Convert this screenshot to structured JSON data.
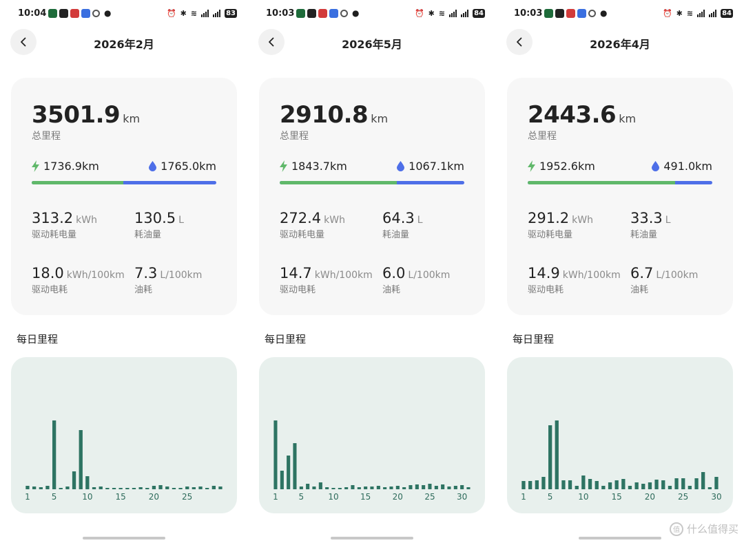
{
  "theme": {
    "accent_bar": "#2e7463",
    "elec_color": "#60b86a",
    "fuel_color": "#4e6fe8",
    "chart_bg": "#e8f0ed",
    "card_bg": "#f7f7f7"
  },
  "phones": [
    {
      "status": {
        "time": "10:04",
        "battery": "83"
      },
      "header": {
        "title": "2026年2月"
      },
      "summary": {
        "total_value": "3501.9",
        "total_unit": "km",
        "total_label": "总里程",
        "elec_km": "1736.9km",
        "fuel_km": "1765.0km",
        "elec_share": 0.496,
        "metrics": [
          {
            "value": "313.2",
            "unit": "kWh",
            "label": "驱动耗电量"
          },
          {
            "value": "130.5",
            "unit": "L",
            "label": "耗油量"
          },
          {
            "value": "18.0",
            "unit": "kWh/100km",
            "label": "驱动电耗"
          },
          {
            "value": "7.3",
            "unit": "L/100km",
            "label": "油耗"
          }
        ]
      },
      "section_title": "每日里程",
      "chart_data": {
        "type": "bar",
        "title": "",
        "categories": [
          1,
          2,
          3,
          4,
          5,
          6,
          7,
          8,
          9,
          10,
          11,
          12,
          13,
          14,
          15,
          16,
          17,
          18,
          19,
          20,
          21,
          22,
          23,
          24,
          25,
          26,
          27,
          28
        ],
        "tick_labels": [
          "1",
          "5",
          "10",
          "15",
          "20",
          "25"
        ],
        "tick_positions": [
          1,
          5,
          10,
          15,
          20,
          25
        ],
        "values": [
          5,
          4,
          3,
          5,
          100,
          2,
          4,
          26,
          86,
          19,
          3,
          4,
          1,
          1,
          2,
          1,
          2,
          3,
          2,
          5,
          6,
          4,
          1,
          2,
          4,
          3,
          4,
          2,
          5,
          4
        ],
        "ylim": [
          0,
          100
        ]
      }
    },
    {
      "status": {
        "time": "10:03",
        "battery": "84"
      },
      "header": {
        "title": "2026年5月"
      },
      "summary": {
        "total_value": "2910.8",
        "total_unit": "km",
        "total_label": "总里程",
        "elec_km": "1843.7km",
        "fuel_km": "1067.1km",
        "elec_share": 0.633,
        "metrics": [
          {
            "value": "272.4",
            "unit": "kWh",
            "label": "驱动耗电量"
          },
          {
            "value": "64.3",
            "unit": "L",
            "label": "耗油量"
          },
          {
            "value": "14.7",
            "unit": "kWh/100km",
            "label": "驱动电耗"
          },
          {
            "value": "6.0",
            "unit": "L/100km",
            "label": "油耗"
          }
        ]
      },
      "section_title": "每日里程",
      "chart_data": {
        "type": "bar",
        "title": "",
        "categories": [
          1,
          2,
          3,
          4,
          5,
          6,
          7,
          8,
          9,
          10,
          11,
          12,
          13,
          14,
          15,
          16,
          17,
          18,
          19,
          20,
          21,
          22,
          23,
          24,
          25,
          26,
          27,
          28,
          29,
          30,
          31
        ],
        "tick_labels": [
          "1",
          "5",
          "10",
          "15",
          "20",
          "25",
          "30"
        ],
        "tick_positions": [
          1,
          5,
          10,
          15,
          20,
          25,
          30
        ],
        "values": [
          100,
          27,
          49,
          67,
          4,
          8,
          4,
          10,
          3,
          2,
          2,
          3,
          6,
          3,
          4,
          4,
          5,
          3,
          4,
          5,
          3,
          6,
          7,
          6,
          8,
          5,
          7,
          4,
          5,
          6,
          3
        ],
        "ylim": [
          0,
          100
        ]
      }
    },
    {
      "status": {
        "time": "10:03",
        "battery": "84"
      },
      "header": {
        "title": "2026年4月"
      },
      "summary": {
        "total_value": "2443.6",
        "total_unit": "km",
        "total_label": "总里程",
        "elec_km": "1952.6km",
        "fuel_km": "491.0km",
        "elec_share": 0.8,
        "metrics": [
          {
            "value": "291.2",
            "unit": "kWh",
            "label": "驱动耗电量"
          },
          {
            "value": "33.3",
            "unit": "L",
            "label": "耗油量"
          },
          {
            "value": "14.9",
            "unit": "kWh/100km",
            "label": "驱动电耗"
          },
          {
            "value": "6.7",
            "unit": "L/100km",
            "label": "油耗"
          }
        ]
      },
      "section_title": "每日里程",
      "chart_data": {
        "type": "bar",
        "title": "",
        "categories": [
          1,
          2,
          3,
          4,
          5,
          6,
          7,
          8,
          9,
          10,
          11,
          12,
          13,
          14,
          15,
          16,
          17,
          18,
          19,
          20,
          21,
          22,
          23,
          24,
          25,
          26,
          27,
          28,
          29,
          30
        ],
        "tick_labels": [
          "1",
          "5",
          "10",
          "15",
          "20",
          "25",
          "30"
        ],
        "tick_positions": [
          1,
          5,
          10,
          15,
          20,
          25,
          30
        ],
        "values": [
          12,
          12,
          13,
          18,
          93,
          100,
          13,
          13,
          5,
          20,
          15,
          12,
          5,
          10,
          13,
          15,
          5,
          10,
          8,
          10,
          14,
          13,
          5,
          16,
          16,
          5,
          16,
          25,
          3,
          18
        ],
        "ylim": [
          0,
          100
        ]
      }
    }
  ],
  "watermark": {
    "text": "什么值得买",
    "icon": "值"
  }
}
